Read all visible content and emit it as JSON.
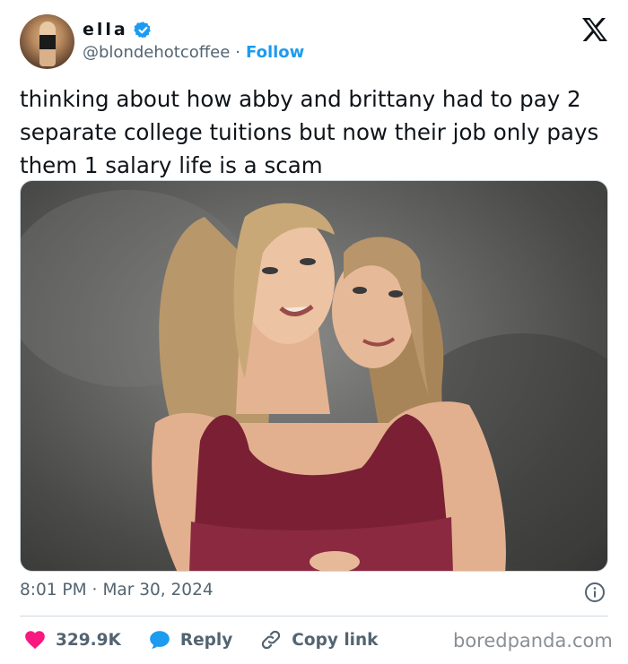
{
  "author": {
    "display_name": "ella",
    "handle": "@blondehotcoffee",
    "separator": "·",
    "follow_label": "Follow"
  },
  "tweet": {
    "text": "thinking about how abby and brittany had to pay 2 separate college tuitions but now their job only pays them 1 salary life is a scam",
    "time": "8:01 PM",
    "date": "Mar 30, 2024",
    "separator": "·"
  },
  "actions": {
    "like_count": "329.9K",
    "reply_label": "Reply",
    "copy_link_label": "Copy link"
  },
  "watermark": "boredpanda.com",
  "icons": {
    "verified": "verified-badge-icon",
    "x_logo": "x-logo-icon",
    "info": "info-icon",
    "heart": "heart-icon",
    "reply": "reply-bubble-icon",
    "link": "link-icon"
  },
  "colors": {
    "accent": "#1d9bf0",
    "like": "#f91880",
    "text": "#0f1419",
    "muted": "#536471"
  }
}
